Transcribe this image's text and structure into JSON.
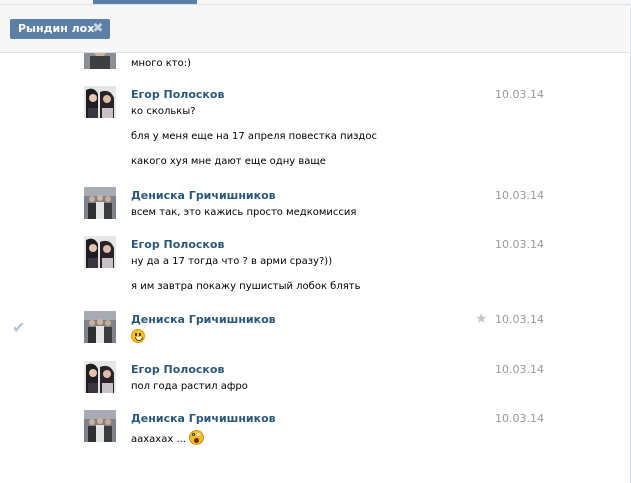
{
  "filter": {
    "chip_label": "Рындин лох",
    "chip_close": "✖"
  },
  "messages": [
    {
      "author": "",
      "date": "",
      "lines": [
        "много кто:)"
      ]
    },
    {
      "author": "Егор Полосков",
      "date": "10.03.14",
      "lines": [
        "ко сколькы?",
        "бля у меня еще на 17 апреля повестка пиздос",
        "какого хуя мне дают еще одну ваще"
      ]
    },
    {
      "author": "Дениска Гричишников",
      "date": "10.03.14",
      "lines": [
        "всем так, это кажись просто медкомиссия"
      ]
    },
    {
      "author": "Егор Полосков",
      "date": "10.03.14",
      "lines": [
        "ну да а 17 тогда что ? в арми сразу?))",
        "я им завтра покажу пушистый лобок блять"
      ]
    },
    {
      "author": "Дениска Гричишников",
      "date": "10.03.14",
      "lines": [
        ""
      ],
      "emoji": "smile-emoji",
      "selected_icon": "checkmark-icon",
      "star_icon": "star-icon"
    },
    {
      "author": "Егор Полосков",
      "date": "10.03.14",
      "lines": [
        "пол года растил афро"
      ]
    },
    {
      "author": "Дениска Гричишников",
      "date": "10.03.14",
      "lines": [
        "аахахах ..."
      ],
      "emoji": "scared-emoji"
    }
  ],
  "icons": {
    "check": "✔",
    "star": "★"
  },
  "colors": {
    "accent": "#5b7fa6",
    "author": "#2b587a",
    "date": "#999999"
  }
}
